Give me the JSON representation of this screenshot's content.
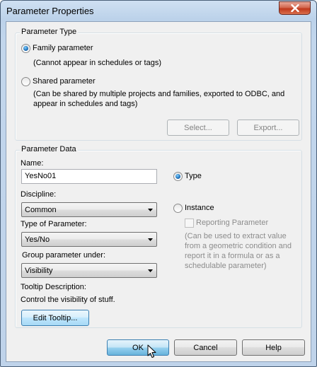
{
  "window": {
    "title": "Parameter Properties"
  },
  "parameter_type": {
    "group_label": "Parameter Type",
    "family_label": "Family parameter",
    "family_desc": "(Cannot appear in schedules or tags)",
    "family_selected": true,
    "shared_label": "Shared parameter",
    "shared_desc_line1": "(Can be shared by multiple projects and families, exported to ODBC, and",
    "shared_desc_line2": "appear in schedules and tags)",
    "shared_selected": false,
    "select_button": "Select...",
    "export_button": "Export..."
  },
  "parameter_data": {
    "group_label": "Parameter Data",
    "name_label": "Name:",
    "name_value": "YesNo01",
    "discipline_label": "Discipline:",
    "discipline_value": "Common",
    "type_of_parameter_label": "Type of Parameter:",
    "type_of_parameter_value": "Yes/No",
    "group_under_label": "Group parameter under:",
    "group_under_value": "Visibility",
    "tooltip_label": "Tooltip Description:",
    "tooltip_value": "Control the visibility of stuff.",
    "edit_tooltip_button": "Edit Tooltip...",
    "type_radio_label": "Type",
    "type_selected": true,
    "instance_radio_label": "Instance",
    "instance_selected": false,
    "reporting_label": "Reporting Parameter",
    "reporting_desc_line1": "(Can be used to extract value",
    "reporting_desc_line2": "from a geometric condition and",
    "reporting_desc_line3": "report it in a formula or as a",
    "reporting_desc_line4": "schedulable parameter)"
  },
  "footer": {
    "ok_button": "OK",
    "cancel_button": "Cancel",
    "help_button": "Help"
  }
}
